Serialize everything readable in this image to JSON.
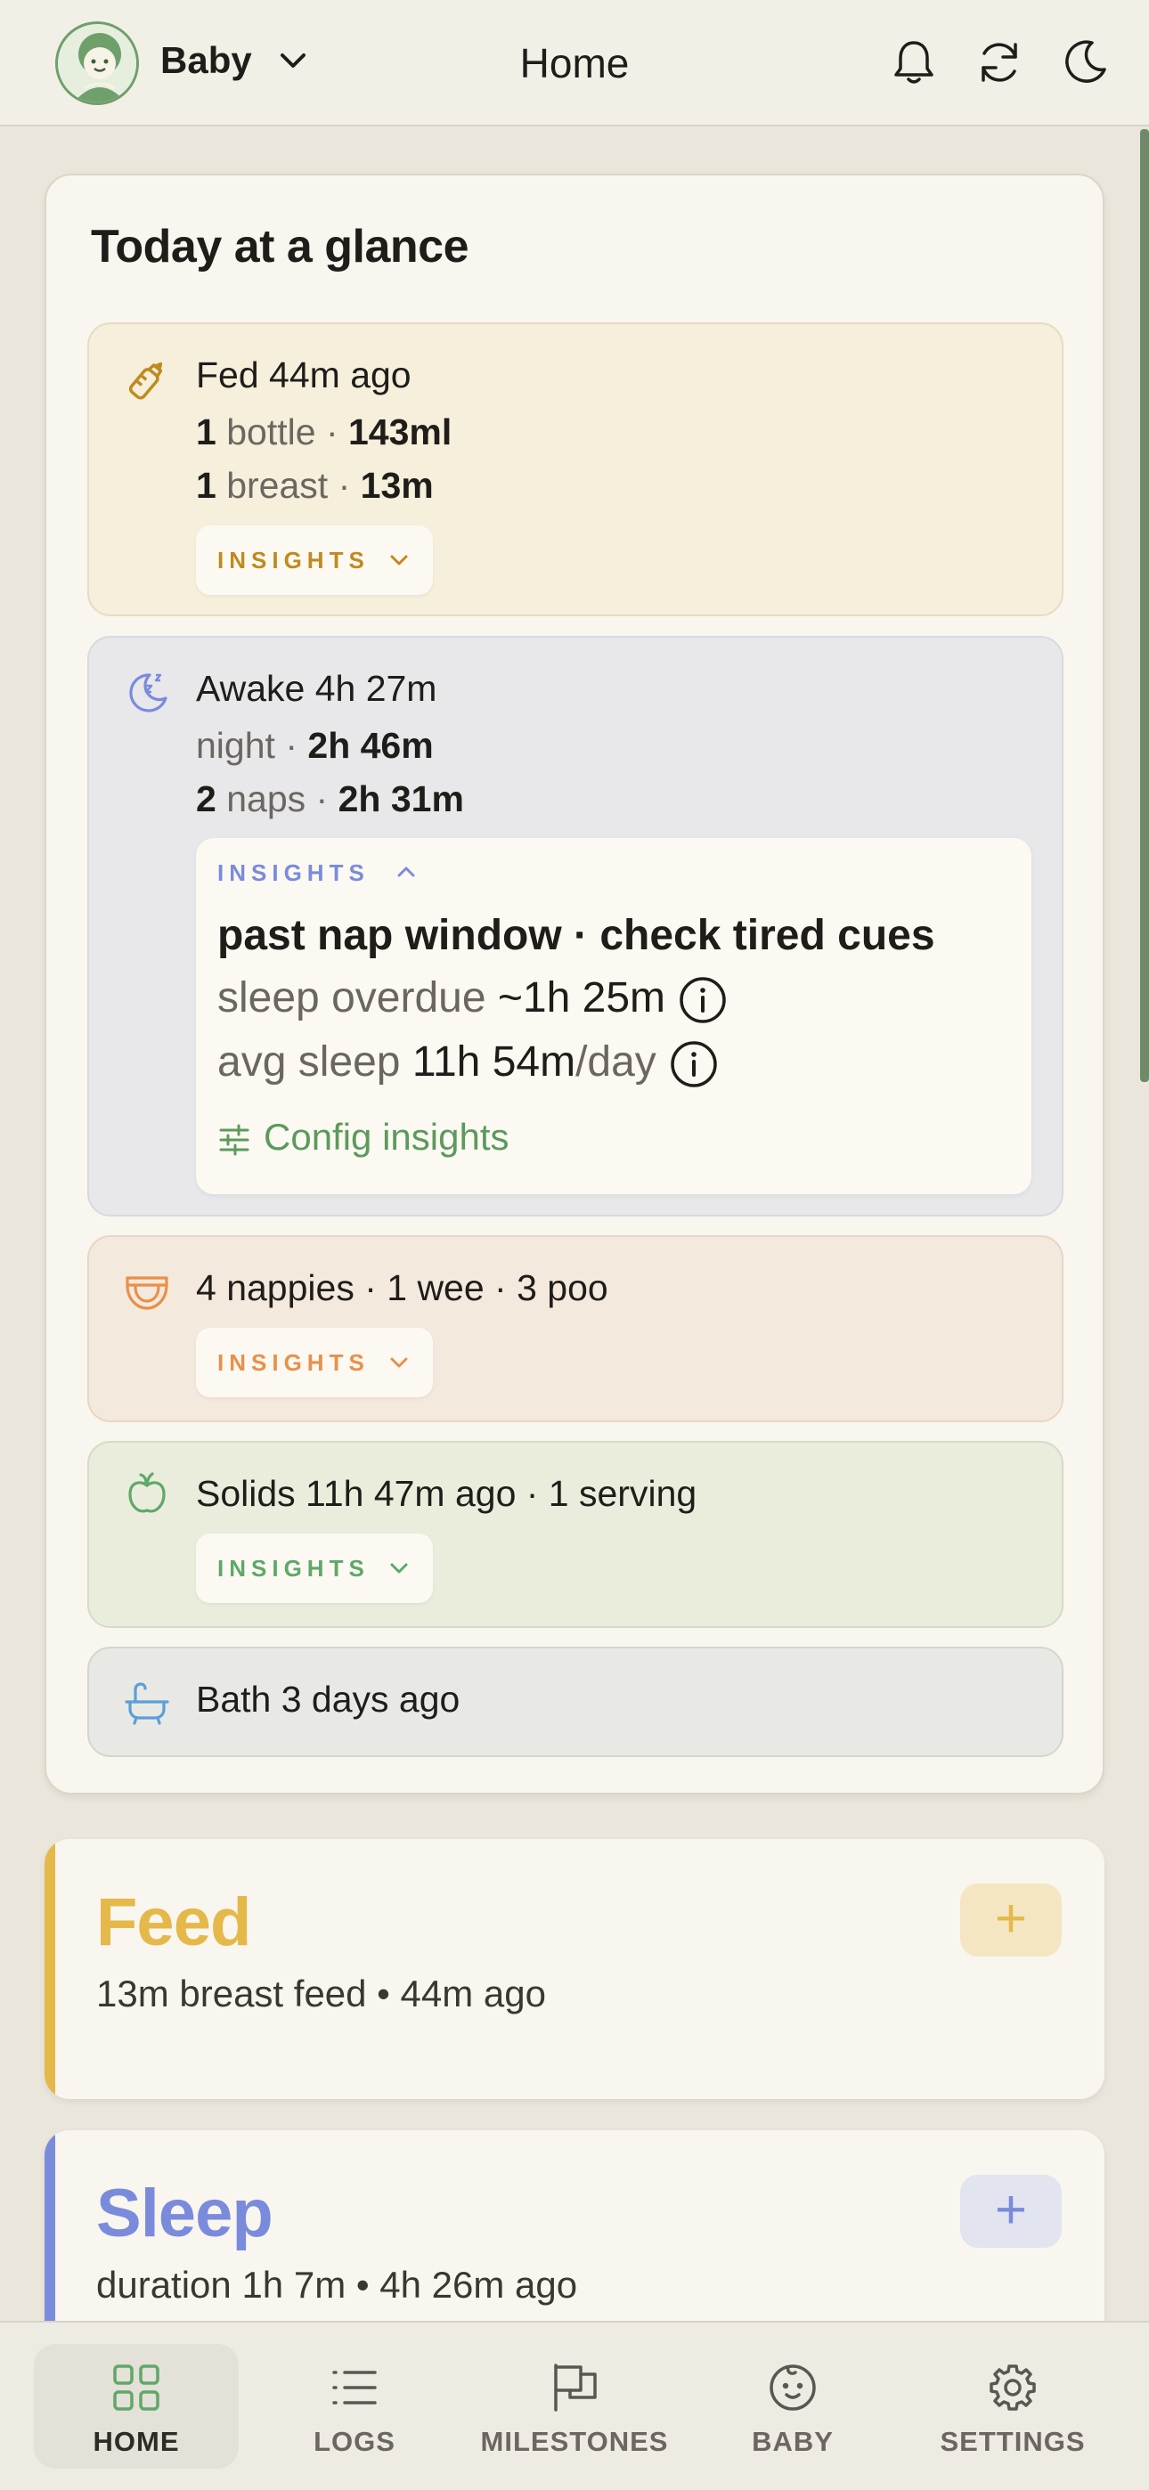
{
  "header": {
    "baby_name": "Baby",
    "title": "Home",
    "icons": [
      "bell-icon",
      "refresh-icon",
      "moon-icon"
    ]
  },
  "glance": {
    "title": "Today at a glance",
    "feed": {
      "icon": "bottle-icon",
      "headline": "Fed 44m ago",
      "bottle_count": "1",
      "bottle_word": "bottle",
      "sep": "·",
      "bottle_amount": "143ml",
      "breast_count": "1",
      "breast_word": "breast",
      "breast_duration": "13m",
      "insights_label": "INSIGHTS",
      "color": "#c08a1e"
    },
    "sleep": {
      "icon": "moon-zzz-icon",
      "headline": "Awake 4h 27m",
      "night_word": "night",
      "night_duration": "2h 46m",
      "naps_count": "2",
      "naps_word": "naps",
      "naps_duration": "2h 31m",
      "insights_label": "INSIGHTS",
      "insight_title": "past nap window · check tired cues",
      "overdue_label": "sleep overdue",
      "overdue_value": "~1h 25m",
      "avg_label": "avg sleep",
      "avg_value": "11h 54m",
      "avg_unit": "/day",
      "config_label": "Config insights",
      "color": "#7b8bdc"
    },
    "nappy": {
      "icon": "nappy-icon",
      "headline": "4 nappies · 1 wee · 3 poo",
      "insights_label": "INSIGHTS",
      "color": "#e8904a"
    },
    "solids": {
      "icon": "apple-icon",
      "headline": "Solids 11h 47m ago · 1 serving",
      "insights_label": "INSIGHTS",
      "color": "#5fa869"
    },
    "bath": {
      "icon": "bathtub-icon",
      "headline": "Bath 3 days ago",
      "color": "#5b9fd6"
    }
  },
  "cards": {
    "feed": {
      "title": "Feed",
      "subtitle": "13m breast feed • 44m ago",
      "add_label": "+",
      "color": "#e5b84a"
    },
    "sleep": {
      "title": "Sleep",
      "subtitle": "duration 1h 7m • 4h 26m ago",
      "add_label": "+",
      "color": "#7b8bdc"
    }
  },
  "nav": {
    "items": [
      {
        "label": "HOME",
        "icon": "grid-icon",
        "active": true
      },
      {
        "label": "LOGS",
        "icon": "list-icon",
        "active": false
      },
      {
        "label": "MILESTONES",
        "icon": "flag-icon",
        "active": false
      },
      {
        "label": "BABY",
        "icon": "baby-face-icon",
        "active": false
      },
      {
        "label": "SETTINGS",
        "icon": "gear-icon",
        "active": false
      }
    ]
  }
}
